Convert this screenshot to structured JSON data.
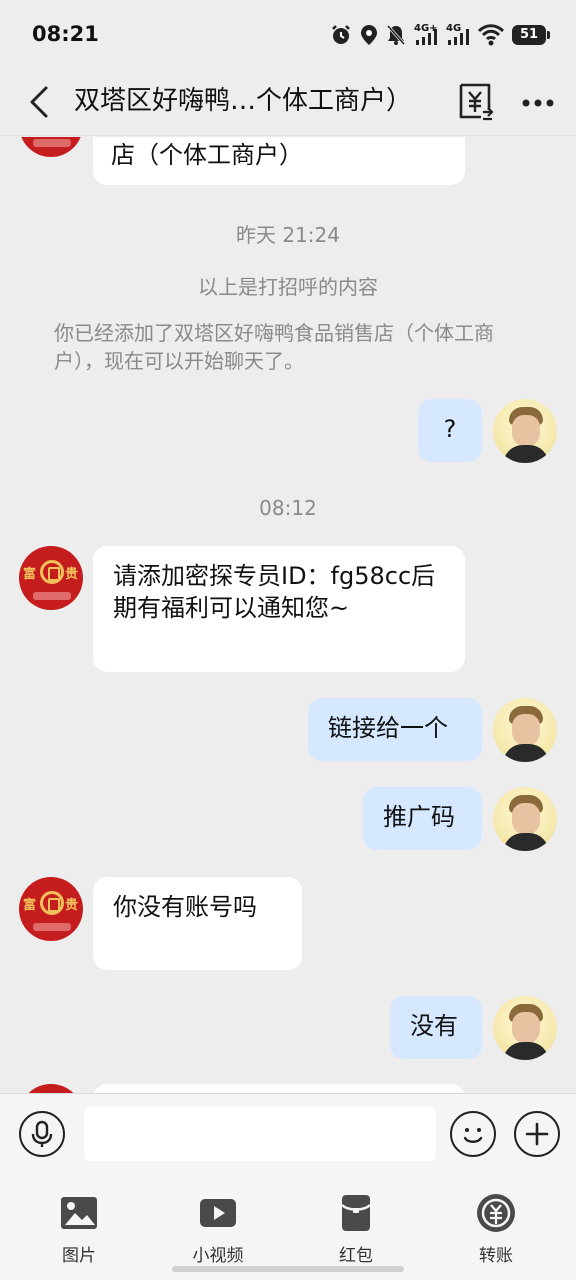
{
  "status_bar": {
    "time": "08:21",
    "network_1": "4G+",
    "network_2": "4G",
    "battery": "51"
  },
  "nav": {
    "title": "双塔区好嗨鸭…个体工商户）"
  },
  "messages": {
    "m0_text": "店（个体工商户）",
    "time_1": "昨天 21:24",
    "greeting_note": "以上是打招呼的内容",
    "added_note": "你已经添加了双塔区好嗨鸭食品销售店（个体工商户），现在可以开始聊天了。",
    "m1_text": "?",
    "time_2": "08:12",
    "m2_text": "请添加密探专员ID：fg58cc后期有福利可以通知您~",
    "m3_text": "链接给一个",
    "m4_text": "推广码",
    "m5_text": "你没有账号吗",
    "m6_text": "没有"
  },
  "shop_avatar": {
    "left_char": "富",
    "right_char": "贵"
  },
  "toolbar": {
    "items": [
      {
        "label": "图片",
        "icon": "image-icon"
      },
      {
        "label": "小视频",
        "icon": "video-icon"
      },
      {
        "label": "红包",
        "icon": "red-packet-icon"
      },
      {
        "label": "转账",
        "icon": "transfer-icon"
      }
    ]
  },
  "colors": {
    "background": "#ededed",
    "bubble_self": "#d6e8ff",
    "bubble_other": "#ffffff",
    "shop_avatar": "#c51d1d"
  }
}
